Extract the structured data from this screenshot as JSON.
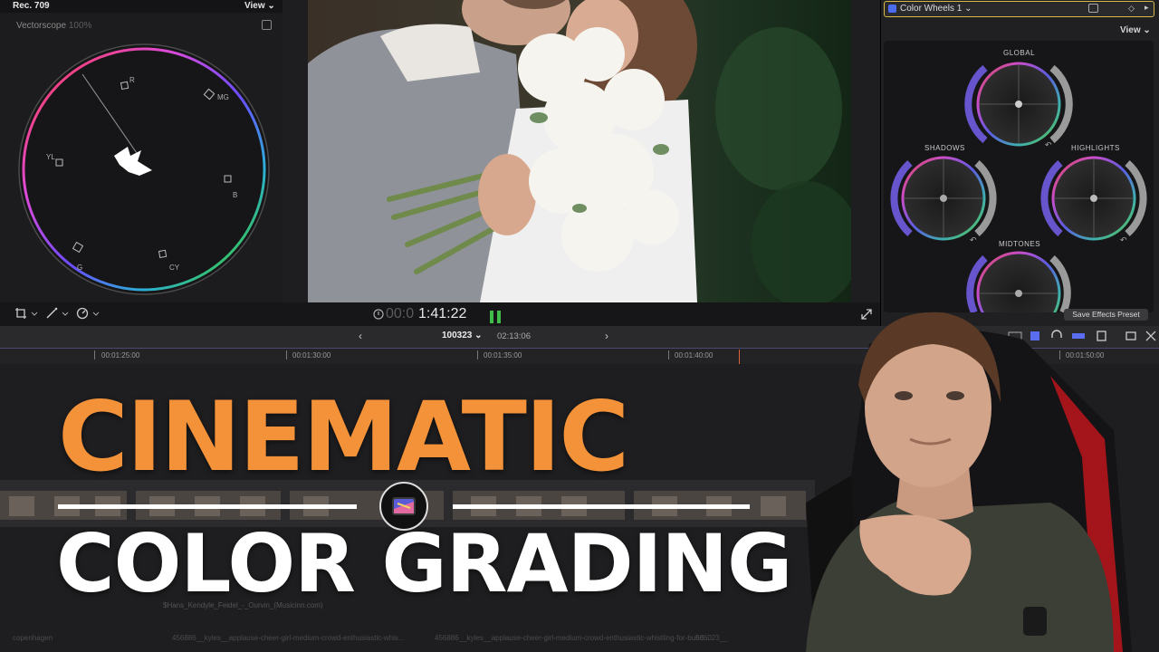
{
  "scope": {
    "title": "Rec. 709",
    "view_label": "View",
    "label": "Vectorscope",
    "percent": "100%",
    "targets": [
      "R",
      "MG",
      "B",
      "CY",
      "G",
      "YL"
    ]
  },
  "inspector": {
    "effect_name": "Color Wheels 1",
    "view_label": "View",
    "wheels": [
      "GLOBAL",
      "SHADOWS",
      "HIGHLIGHTS",
      "MIDTONES"
    ],
    "save_preset_label": "Save Effects Preset"
  },
  "toolbar": {
    "timecode_dim": "00:0",
    "timecode": "1:41:22"
  },
  "timeline": {
    "project": "100323",
    "duration": "02:13:06",
    "ticks": [
      "00:01:25:00",
      "00:01:30:00",
      "00:01:35:00",
      "00:01:40:00",
      "00:01:50:00"
    ],
    "audio_label": "$Hans_Kendyle_Feidel_-_Ourvin_(Musicinn.com)",
    "bottom_labels": [
      "copenhagen",
      "456886__kyles__applause-cheer-girl-medium-crowd-enthusiastic-whis...",
      "456886__kyles__applause-cheer-girl-medium-crowd-enthusiastic-whistling-for-bund...",
      "566023__"
    ]
  },
  "overlay": {
    "line1": "CINEMATIC",
    "line2": "COLOR GRADING"
  },
  "colors": {
    "title_orange": "#f4923a",
    "effect_outline": "#d9b84a",
    "playhead": "#e0603a"
  }
}
